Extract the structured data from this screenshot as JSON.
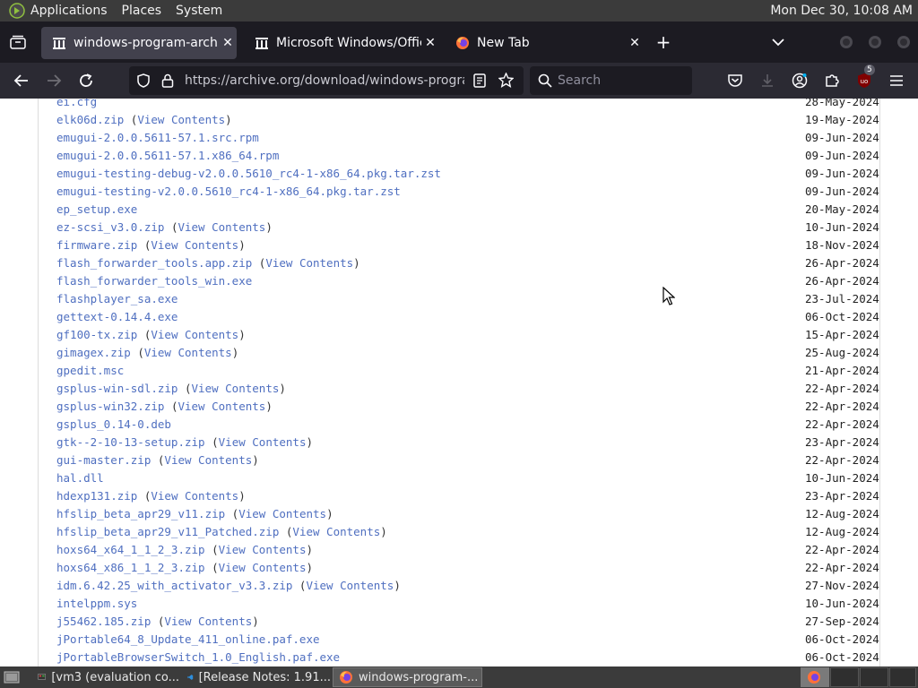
{
  "system_bar": {
    "menus": [
      "Applications",
      "Places",
      "System"
    ],
    "clock": "Mon Dec 30, 10:08 AM"
  },
  "tabs": [
    {
      "label": "windows-program-archive",
      "active": true
    },
    {
      "label": "Microsoft Windows/Office A",
      "active": false
    },
    {
      "label": "New Tab",
      "active": false
    }
  ],
  "toolbar": {
    "url": "https://archive.org/download/windows-program-archive",
    "search_placeholder": "Search",
    "extension_badge": "5"
  },
  "listing": {
    "view_contents_label": "View Contents",
    "files": [
      {
        "name": "ei.cfg",
        "date": "28-May-2024",
        "view": false
      },
      {
        "name": "elk06d.zip",
        "date": "19-May-2024",
        "view": true
      },
      {
        "name": "emugui-2.0.0.5611-57.1.src.rpm",
        "date": "09-Jun-2024",
        "view": false
      },
      {
        "name": "emugui-2.0.0.5611-57.1.x86_64.rpm",
        "date": "09-Jun-2024",
        "view": false
      },
      {
        "name": "emugui-testing-debug-v2.0.0.5610_rc4-1-x86_64.pkg.tar.zst",
        "date": "09-Jun-2024",
        "view": false
      },
      {
        "name": "emugui-testing-v2.0.0.5610_rc4-1-x86_64.pkg.tar.zst",
        "date": "09-Jun-2024",
        "view": false
      },
      {
        "name": "ep_setup.exe",
        "date": "20-May-2024",
        "view": false
      },
      {
        "name": "ez-scsi_v3.0.zip",
        "date": "10-Jun-2024",
        "view": true
      },
      {
        "name": "firmware.zip",
        "date": "18-Nov-2024",
        "view": true
      },
      {
        "name": "flash_forwarder_tools.app.zip",
        "date": "26-Apr-2024",
        "view": true
      },
      {
        "name": "flash_forwarder_tools_win.exe",
        "date": "26-Apr-2024",
        "view": false
      },
      {
        "name": "flashplayer_sa.exe",
        "date": "23-Jul-2024",
        "view": false
      },
      {
        "name": "gettext-0.14.4.exe",
        "date": "06-Oct-2024",
        "view": false
      },
      {
        "name": "gf100-tx.zip",
        "date": "15-Apr-2024",
        "view": true
      },
      {
        "name": "gimagex.zip",
        "date": "25-Aug-2024",
        "view": true
      },
      {
        "name": "gpedit.msc",
        "date": "21-Apr-2024",
        "view": false
      },
      {
        "name": "gsplus-win-sdl.zip",
        "date": "22-Apr-2024",
        "view": true
      },
      {
        "name": "gsplus-win32.zip",
        "date": "22-Apr-2024",
        "view": true
      },
      {
        "name": "gsplus_0.14-0.deb",
        "date": "22-Apr-2024",
        "view": false
      },
      {
        "name": "gtk--2-10-13-setup.zip",
        "date": "23-Apr-2024",
        "view": true
      },
      {
        "name": "gui-master.zip",
        "date": "22-Apr-2024",
        "view": true
      },
      {
        "name": "hal.dll",
        "date": "10-Jun-2024",
        "view": false
      },
      {
        "name": "hdexp131.zip",
        "date": "23-Apr-2024",
        "view": true
      },
      {
        "name": "hfslip_beta_apr29_v11.zip",
        "date": "12-Aug-2024",
        "view": true
      },
      {
        "name": "hfslip_beta_apr29_v11_Patched.zip",
        "date": "12-Aug-2024",
        "view": true
      },
      {
        "name": "hoxs64_x64_1_1_2_3.zip",
        "date": "22-Apr-2024",
        "view": true
      },
      {
        "name": "hoxs64_x86_1_1_2_3.zip",
        "date": "22-Apr-2024",
        "view": true
      },
      {
        "name": "idm.6.42.25_with_activator_v3.3.zip",
        "date": "27-Nov-2024",
        "view": true
      },
      {
        "name": "intelppm.sys",
        "date": "10-Jun-2024",
        "view": false
      },
      {
        "name": "j55462.185.zip",
        "date": "27-Sep-2024",
        "view": true
      },
      {
        "name": "jPortable64_8_Update_411_online.paf.exe",
        "date": "06-Oct-2024",
        "view": false
      },
      {
        "name": "jPortableBrowserSwitch_1.0_English.paf.exe",
        "date": "06-Oct-2024",
        "view": false
      }
    ]
  },
  "taskbar": {
    "items": [
      {
        "label": "[vm3 (evaluation co...",
        "active": false
      },
      {
        "label": "[Release Notes: 1.91...",
        "active": false
      },
      {
        "label": "windows-program-...",
        "active": true
      }
    ]
  },
  "colors": {
    "link": "#4f6fc0",
    "tab_bar": "#1c1b22",
    "toolbar": "#2b2a33",
    "system_bar": "#3b3b3b"
  }
}
